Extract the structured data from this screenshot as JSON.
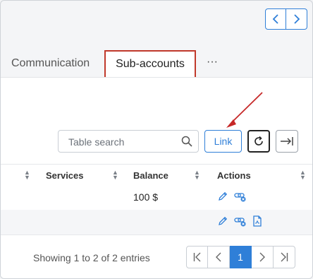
{
  "tabs": {
    "communication": "Communication",
    "sub_accounts": "Sub-accounts",
    "more": "···"
  },
  "toolbar": {
    "search_placeholder": "Table search",
    "link_label": "Link"
  },
  "table": {
    "columns": [
      "Services",
      "Balance",
      "Actions"
    ],
    "rows": [
      {
        "balance": "100 $"
      },
      {
        "balance": ""
      }
    ]
  },
  "footer": {
    "info": "Showing 1 to 2 of 2 entries",
    "current_page": "1"
  },
  "colors": {
    "accent": "#2f7fd8",
    "highlight": "#c0392b"
  }
}
